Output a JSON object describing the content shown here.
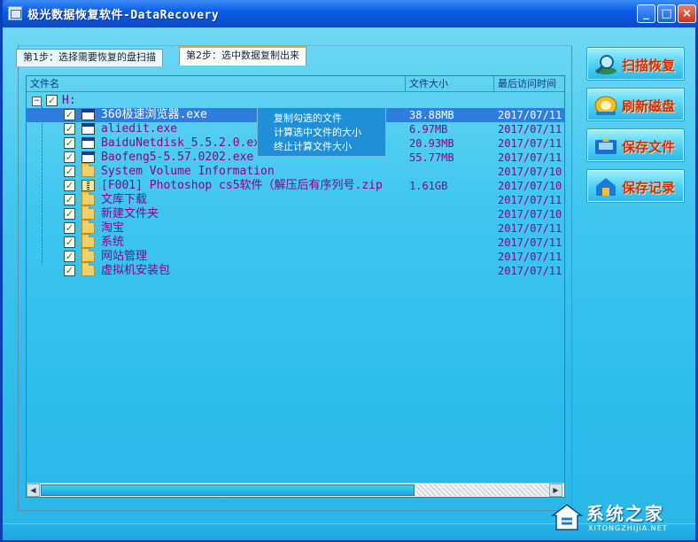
{
  "window": {
    "title": "极光数据恢复软件-DataRecovery",
    "minimize": "_",
    "maximize": "□",
    "close": "×"
  },
  "tabs": [
    {
      "label": "第1步：选择需要恢复的盘扫描",
      "active": false
    },
    {
      "label": "第2步：选中数据复制出来",
      "active": true
    }
  ],
  "columns": {
    "name": "文件名",
    "size": "文件大小",
    "date": "最后访问时间"
  },
  "tree_root": {
    "expander": "−",
    "label": "H:"
  },
  "files": [
    {
      "name": "360极速浏览器.exe",
      "size": "38.88MB",
      "date": "2017/07/11",
      "icon": "exe-icon",
      "selected": true
    },
    {
      "name": "aliedit.exe",
      "size": "6.97MB",
      "date": "2017/07/11",
      "icon": "exe-icon"
    },
    {
      "name": "BaiduNetdisk_5.5.2.0.exe",
      "size": "20.93MB",
      "date": "2017/07/11",
      "icon": "exe-icon"
    },
    {
      "name": "Baofeng5-5.57.0202.exe",
      "size": "55.77MB",
      "date": "2017/07/11",
      "icon": "exe-icon"
    },
    {
      "name": "System Volume Information",
      "size": "",
      "date": "2017/07/10",
      "icon": "folder-icon"
    },
    {
      "name": "[F001] Photoshop cs5软件（解压后有序列号.zip",
      "size": "1.61GB",
      "date": "2017/07/10",
      "icon": "zip-icon"
    },
    {
      "name": "文库下载",
      "size": "",
      "date": "2017/07/11",
      "icon": "folder-icon"
    },
    {
      "name": "新建文件夹",
      "size": "",
      "date": "2017/07/10",
      "icon": "folder-icon"
    },
    {
      "name": "淘宝",
      "size": "",
      "date": "2017/07/11",
      "icon": "folder-icon"
    },
    {
      "name": "系统",
      "size": "",
      "date": "2017/07/11",
      "icon": "folder-icon"
    },
    {
      "name": "网站管理",
      "size": "",
      "date": "2017/07/11",
      "icon": "folder-icon"
    },
    {
      "name": "虚拟机安装包",
      "size": "",
      "date": "2017/07/11",
      "icon": "folder-icon"
    }
  ],
  "context_menu": [
    "复制勾选的文件",
    "计算选中文件的大小",
    "终止计算文件大小"
  ],
  "side_buttons": [
    {
      "label": "扫描恢复",
      "icon": "scan-magnifier-icon"
    },
    {
      "label": "刷新磁盘",
      "icon": "refresh-disk-icon"
    },
    {
      "label": "保存文件",
      "icon": "save-file-icon"
    },
    {
      "label": "保存记录",
      "icon": "save-record-icon"
    }
  ],
  "watermark": {
    "text": "系统之家",
    "sub": "XITONGZHIJIA.NET"
  },
  "colors": {
    "accent": "#d52a10",
    "file_text": "#8a008a",
    "selection": "#2e7ee0",
    "titlebar": "#0b5ee6"
  }
}
